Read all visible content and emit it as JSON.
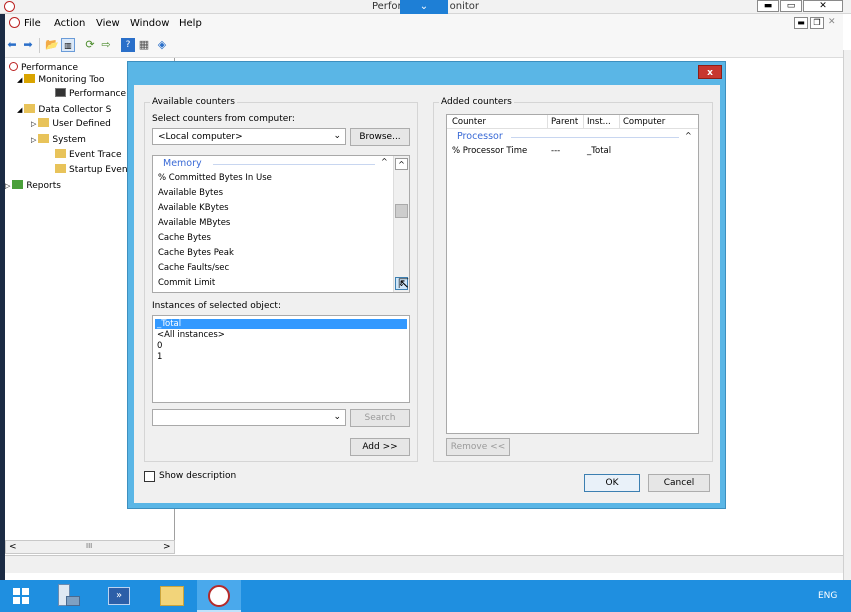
{
  "window": {
    "title_left": "Perfor",
    "title_right": "onitor",
    "minimize": "▬",
    "maximize": "▭",
    "close": "✕"
  },
  "menu": {
    "items": [
      "File",
      "Action",
      "View",
      "Window",
      "Help"
    ]
  },
  "tree": {
    "items": [
      "Performance",
      "Monitoring Too",
      "Performance",
      "Data Collector S",
      "User Defined",
      "System",
      "Event Trace",
      "Startup Even",
      "Reports"
    ]
  },
  "scroll": {
    "left_arrow": "<",
    "thumb": "III",
    "right_arrow": ">"
  },
  "dialog": {
    "close": "x",
    "available_counters_label": "Available counters",
    "select_from_computer_label": "Select counters from computer:",
    "computer_value": "<Local computer>",
    "browse_button": "Browse...",
    "counters_group": "Memory",
    "counters": [
      "% Committed Bytes In Use",
      "Available Bytes",
      "Available KBytes",
      "Available MBytes",
      "Cache Bytes",
      "Cache Bytes Peak",
      "Cache Faults/sec",
      "Commit Limit"
    ],
    "instances_label": "Instances of selected object:",
    "instances": [
      "_Total",
      "<All instances>",
      "0",
      "1"
    ],
    "search_button": "Search",
    "add_button": "Add >>",
    "added_counters_label": "Added counters",
    "added_columns": [
      "Counter",
      "Parent",
      "Inst...",
      "Computer"
    ],
    "added_group": "Processor",
    "added_rows": [
      {
        "counter": "% Processor Time",
        "parent": "---",
        "instance": "_Total",
        "computer": ""
      }
    ],
    "remove_button": "Remove <<",
    "show_description_label": "Show description",
    "ok_button": "OK",
    "cancel_button": "Cancel"
  },
  "taskbar": {
    "lang": "ENG"
  },
  "colors": {
    "accent": "#1e7fd6",
    "taskbar": "#1f8fe0",
    "dialog_border": "#5ab6e6",
    "selection": "#3399ff",
    "group_text": "#3a6ad6",
    "close_red": "#c7372f"
  }
}
